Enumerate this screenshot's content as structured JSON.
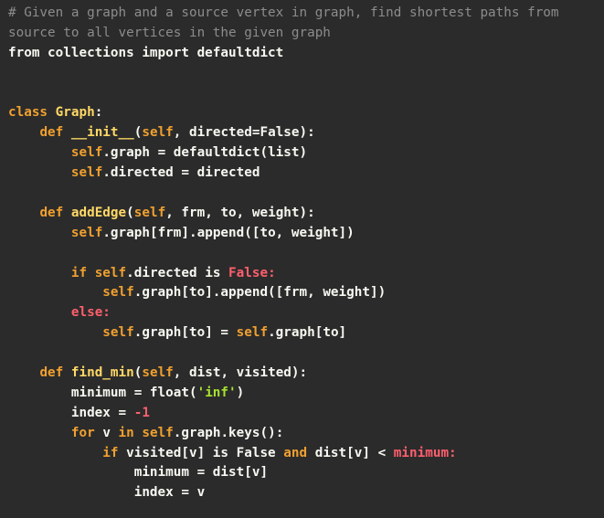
{
  "code_lines": [
    [
      {
        "t": "# Given a graph and a source vertex in graph, find shortest paths from",
        "c": "comment"
      }
    ],
    [
      {
        "t": "source to all vertices in the given graph",
        "c": "comment"
      }
    ],
    [
      {
        "t": "from collections import defaultdict",
        "c": "plain"
      }
    ],
    [],
    [],
    [
      {
        "t": "class ",
        "c": "keyword"
      },
      {
        "t": "Graph",
        "c": "name"
      },
      {
        "t": ":",
        "c": "plain"
      }
    ],
    [
      {
        "t": "    ",
        "c": "plain"
      },
      {
        "t": "def ",
        "c": "keyword"
      },
      {
        "t": "__init__",
        "c": "name"
      },
      {
        "t": "(",
        "c": "plain"
      },
      {
        "t": "self",
        "c": "self"
      },
      {
        "t": ", directed=False):",
        "c": "plain"
      }
    ],
    [
      {
        "t": "        ",
        "c": "plain"
      },
      {
        "t": "self",
        "c": "self"
      },
      {
        "t": ".graph = defaultdict(list)",
        "c": "plain"
      }
    ],
    [
      {
        "t": "        ",
        "c": "plain"
      },
      {
        "t": "self",
        "c": "self"
      },
      {
        "t": ".directed = directed",
        "c": "plain"
      }
    ],
    [],
    [
      {
        "t": "    ",
        "c": "plain"
      },
      {
        "t": "def ",
        "c": "keyword"
      },
      {
        "t": "addEdge",
        "c": "name"
      },
      {
        "t": "(",
        "c": "plain"
      },
      {
        "t": "self",
        "c": "self"
      },
      {
        "t": ", frm, to, weight):",
        "c": "plain"
      }
    ],
    [
      {
        "t": "        ",
        "c": "plain"
      },
      {
        "t": "self",
        "c": "self"
      },
      {
        "t": ".graph[frm].append([to, weight])",
        "c": "plain"
      }
    ],
    [],
    [
      {
        "t": "        ",
        "c": "plain"
      },
      {
        "t": "if ",
        "c": "keyword"
      },
      {
        "t": "self",
        "c": "self"
      },
      {
        "t": ".directed is ",
        "c": "plain"
      },
      {
        "t": "False:",
        "c": "const"
      }
    ],
    [
      {
        "t": "            ",
        "c": "plain"
      },
      {
        "t": "self",
        "c": "self"
      },
      {
        "t": ".graph[to].append([frm, weight])",
        "c": "plain"
      }
    ],
    [
      {
        "t": "        ",
        "c": "plain"
      },
      {
        "t": "else:",
        "c": "const"
      }
    ],
    [
      {
        "t": "            ",
        "c": "plain"
      },
      {
        "t": "self",
        "c": "self"
      },
      {
        "t": ".graph[to] = ",
        "c": "plain"
      },
      {
        "t": "self",
        "c": "self"
      },
      {
        "t": ".graph[to]",
        "c": "plain"
      }
    ],
    [],
    [
      {
        "t": "    ",
        "c": "plain"
      },
      {
        "t": "def ",
        "c": "keyword"
      },
      {
        "t": "find_min",
        "c": "name"
      },
      {
        "t": "(",
        "c": "plain"
      },
      {
        "t": "self",
        "c": "self"
      },
      {
        "t": ", dist, visited):",
        "c": "plain"
      }
    ],
    [
      {
        "t": "        minimum = float(",
        "c": "plain"
      },
      {
        "t": "'inf'",
        "c": "string"
      },
      {
        "t": ")",
        "c": "plain"
      }
    ],
    [
      {
        "t": "        index = ",
        "c": "plain"
      },
      {
        "t": "-1",
        "c": "number"
      }
    ],
    [
      {
        "t": "        ",
        "c": "plain"
      },
      {
        "t": "for ",
        "c": "keyword"
      },
      {
        "t": "v ",
        "c": "plain"
      },
      {
        "t": "in ",
        "c": "keyword"
      },
      {
        "t": "self",
        "c": "self"
      },
      {
        "t": ".graph.keys():",
        "c": "plain"
      }
    ],
    [
      {
        "t": "            ",
        "c": "plain"
      },
      {
        "t": "if ",
        "c": "keyword"
      },
      {
        "t": "visited[v] is False ",
        "c": "plain"
      },
      {
        "t": "and ",
        "c": "keyword"
      },
      {
        "t": "dist[v] < ",
        "c": "plain"
      },
      {
        "t": "minimum:",
        "c": "const"
      }
    ],
    [
      {
        "t": "                minimum = dist[v]",
        "c": "plain"
      }
    ],
    [
      {
        "t": "                index = v",
        "c": "plain"
      }
    ]
  ]
}
